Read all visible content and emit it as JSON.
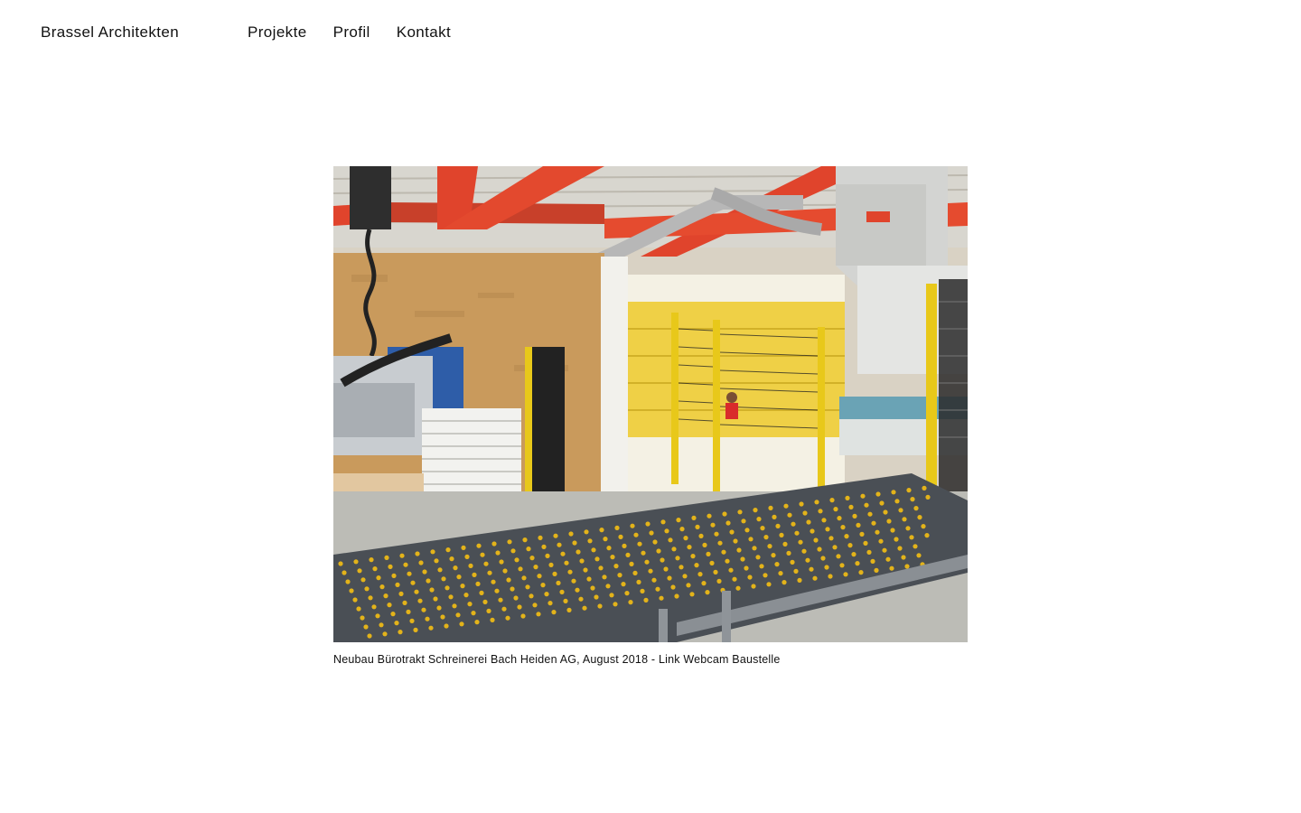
{
  "header": {
    "logo": "Brassel Architekten",
    "nav": [
      {
        "label": "Projekte"
      },
      {
        "label": "Profil"
      },
      {
        "label": "Kontakt"
      }
    ]
  },
  "project": {
    "caption_text": "Neubau Bürotrakt Schreinerei Bach Heiden AG, August 2018 - ",
    "caption_link": "Link Webcam Baustelle"
  },
  "colors": {
    "beam_red": "#e0442c",
    "wall_osb": "#c99a5c",
    "fence_yellow": "#e8c81a",
    "roller_yellow": "#e3b31a"
  }
}
